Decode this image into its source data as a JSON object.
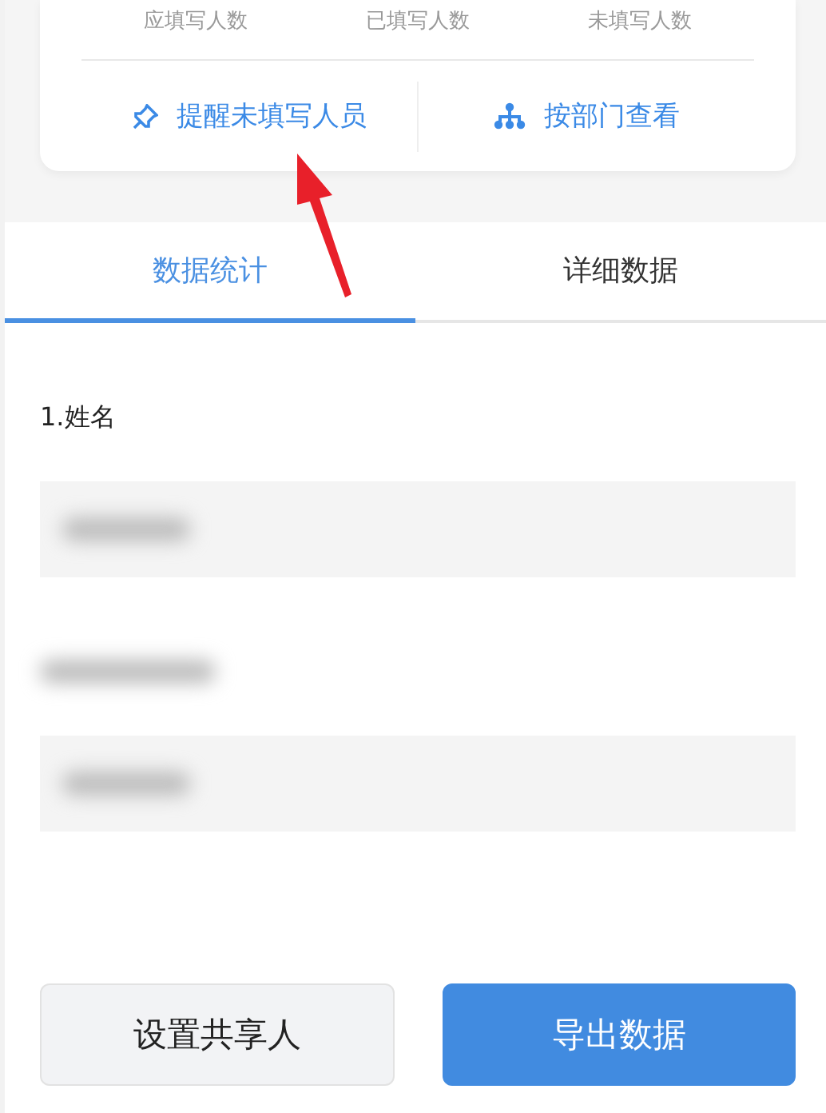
{
  "stats_card": {
    "stat_labels": [
      "应填写人数",
      "已填写人数",
      "未填写人数"
    ],
    "actions": [
      {
        "kind": "pin",
        "label": "提醒未填写人员"
      },
      {
        "kind": "tree",
        "label": "按部门查看"
      }
    ]
  },
  "tabs": [
    {
      "label": "数据统计",
      "selected": true
    },
    {
      "label": "详细数据",
      "selected": false
    }
  ],
  "questions": [
    {
      "title": "1.姓名",
      "title_blurred": false
    },
    {
      "title_blurred": true
    }
  ],
  "buttons": [
    {
      "kind": "secondary",
      "label": "设置共享人"
    },
    {
      "kind": "primary",
      "label": "导出数据"
    }
  ]
}
